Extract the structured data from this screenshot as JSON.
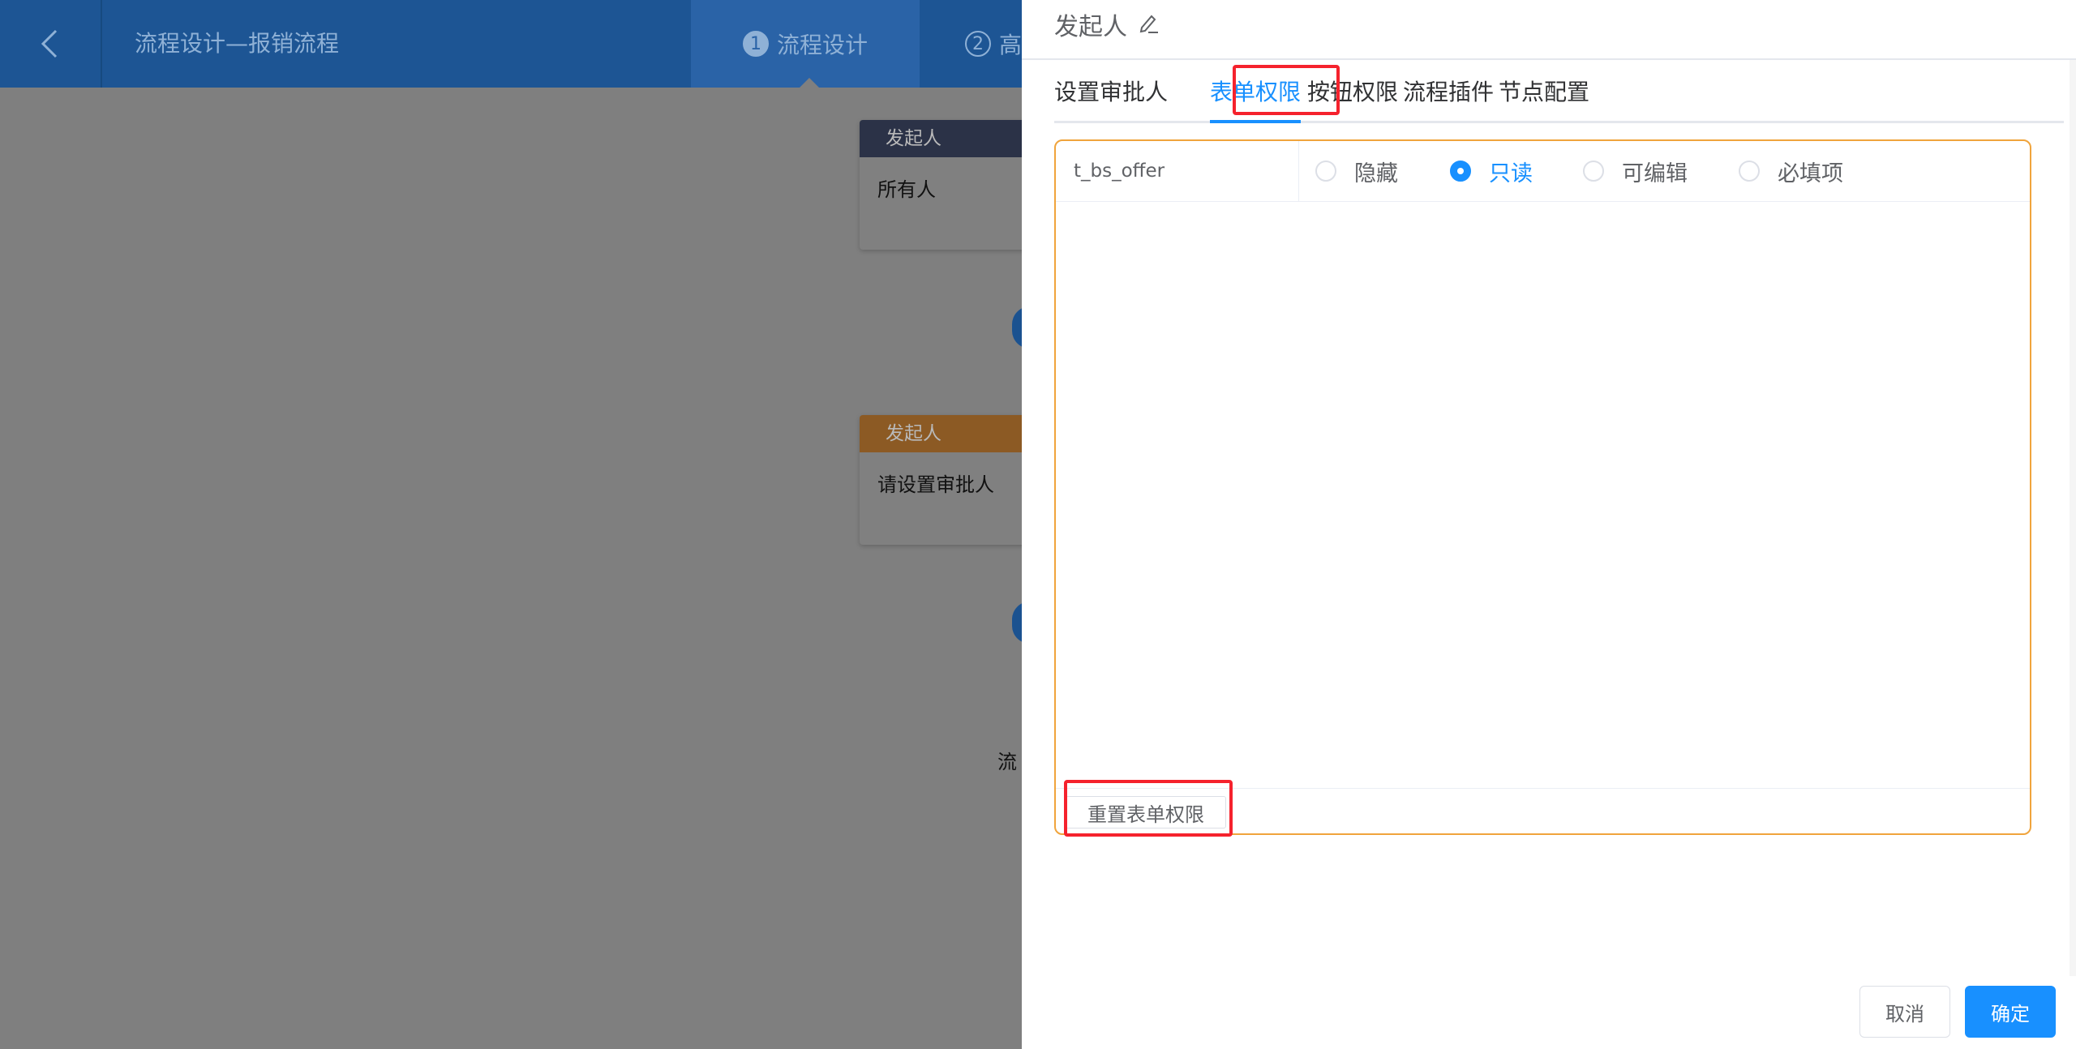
{
  "header": {
    "title": "流程设计—报销流程",
    "steps": [
      {
        "num": "1",
        "label": "流程设计"
      },
      {
        "num": "2",
        "label": "高"
      }
    ]
  },
  "canvas": {
    "nodes": [
      {
        "title": "发起人",
        "content": "所有人"
      },
      {
        "title": "发起人",
        "content": "请设置审批人"
      }
    ],
    "partial_text": "流"
  },
  "drawer": {
    "title": "发起人",
    "tabs": [
      {
        "label": "设置审批人"
      },
      {
        "label": "表单权限"
      },
      {
        "label": "按钮权限"
      },
      {
        "label": "流程插件"
      },
      {
        "label": "节点配置"
      }
    ],
    "active_tab": "表单权限",
    "form_permission": {
      "field": "t_bs_offer",
      "options": [
        {
          "label": "隐藏"
        },
        {
          "label": "只读"
        },
        {
          "label": "可编辑"
        },
        {
          "label": "必填项"
        }
      ],
      "selected": "只读",
      "reset_label": "重置表单权限"
    },
    "footer": {
      "cancel_label": "取消",
      "confirm_label": "确定"
    }
  },
  "colors": {
    "accent": "#1890ff",
    "highlight": "#f5222d",
    "panel_border": "#f0a43c"
  }
}
